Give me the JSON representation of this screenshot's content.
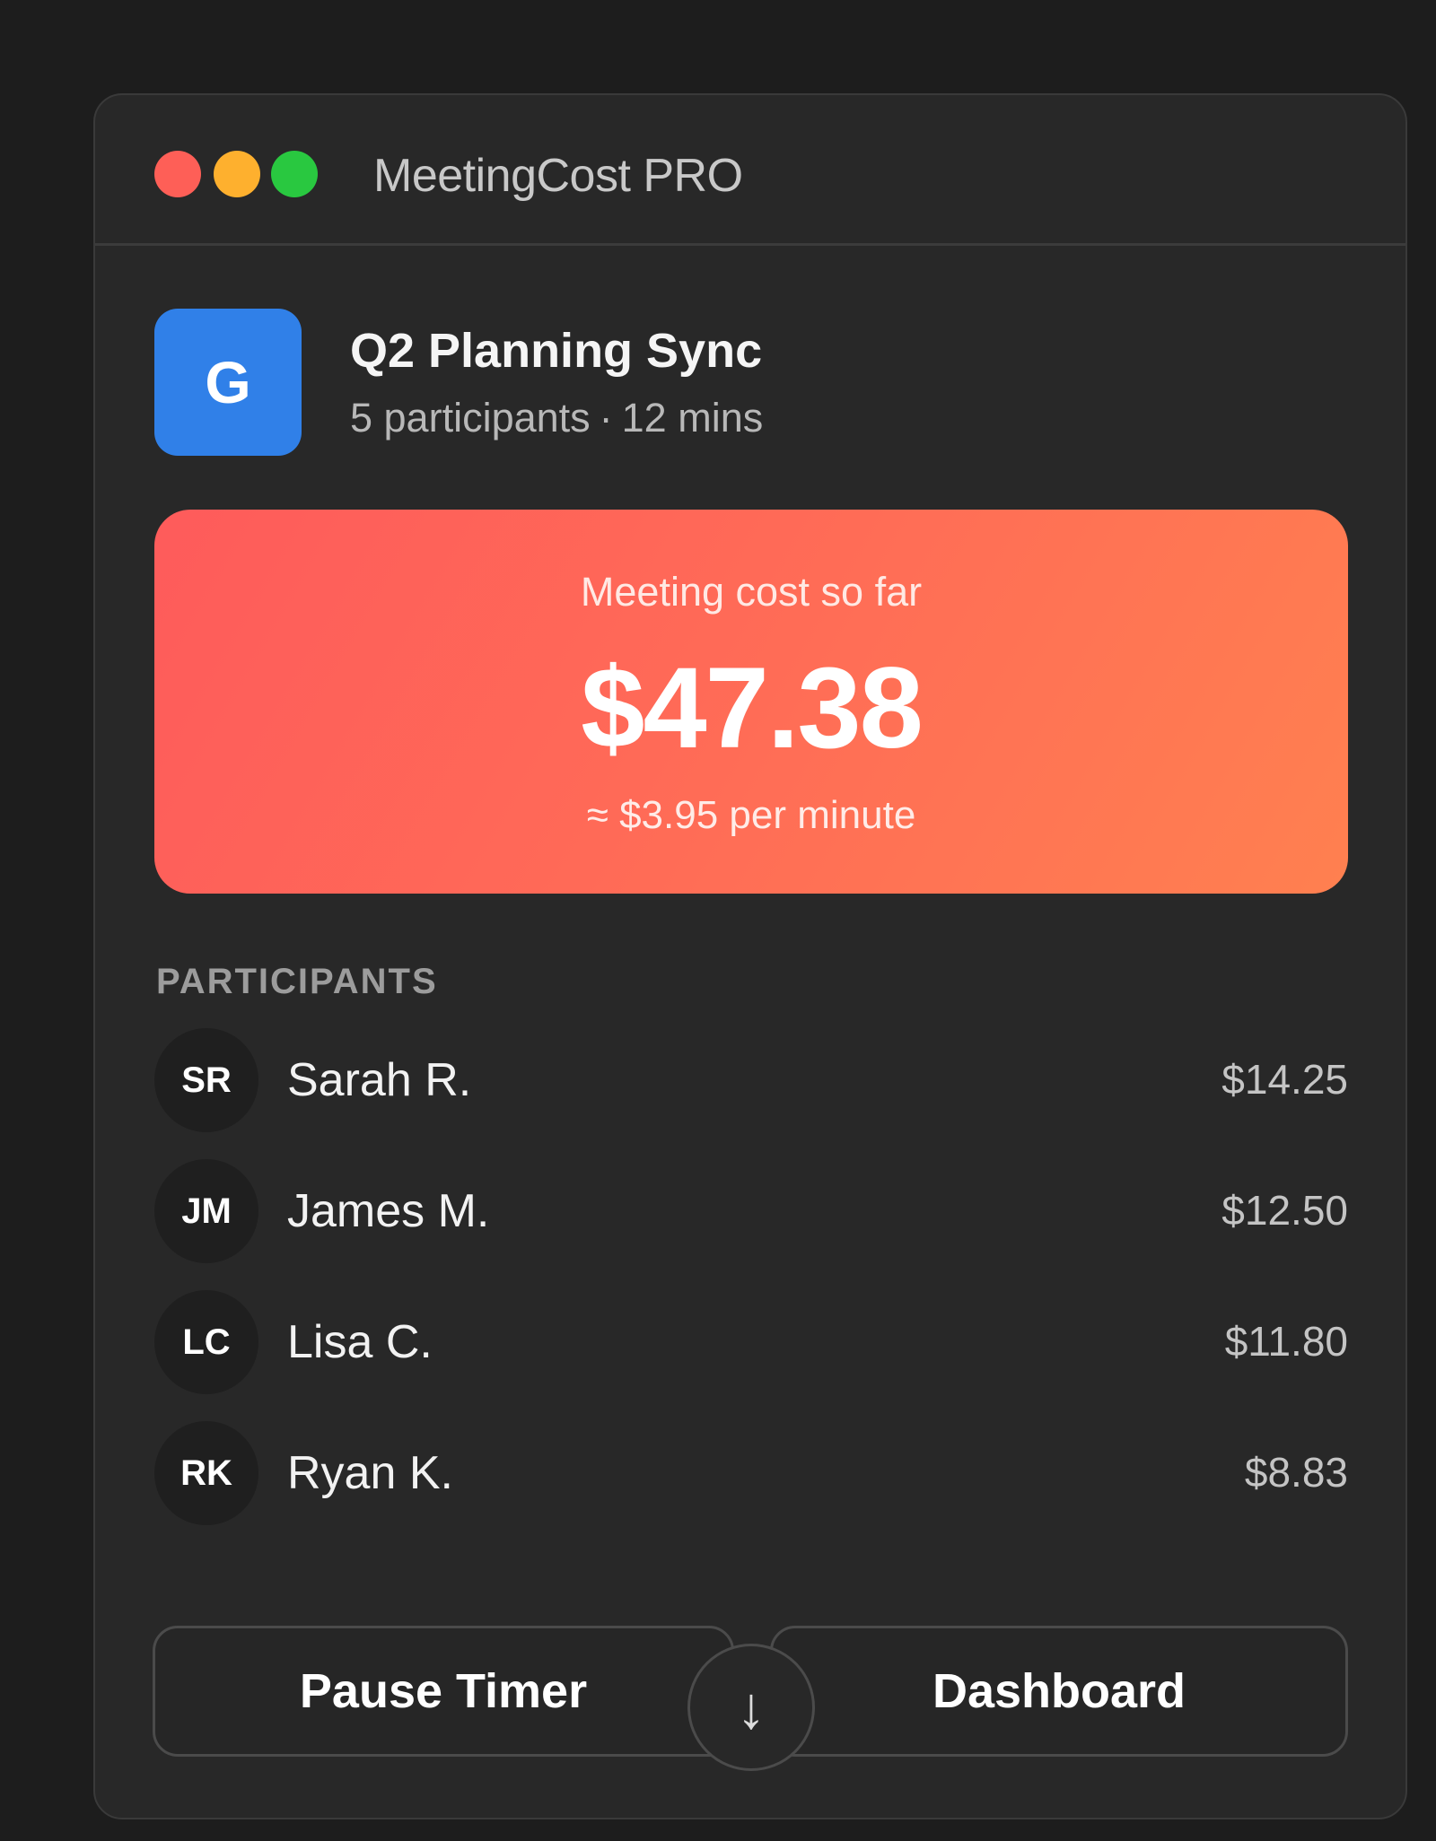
{
  "window": {
    "app_title": "MeetingCost PRO"
  },
  "meeting": {
    "app_icon_letter": "G",
    "title": "Q2 Planning Sync",
    "participants_text": "5 participants",
    "separator": "·",
    "duration_text": "12 mins"
  },
  "cost": {
    "label": "Meeting cost so far",
    "value": "$47.38",
    "rate": "≈ $3.95 per minute"
  },
  "participants": {
    "section_label": "PARTICIPANTS",
    "items": [
      {
        "initials": "SR",
        "name": "Sarah R.",
        "cost": "$14.25"
      },
      {
        "initials": "JM",
        "name": "James M.",
        "cost": "$12.50"
      },
      {
        "initials": "LC",
        "name": "Lisa C.",
        "cost": "$11.80"
      },
      {
        "initials": "RK",
        "name": "Ryan K.",
        "cost": "$8.83"
      }
    ]
  },
  "actions": {
    "pause_label": "Pause Timer",
    "dashboard_label": "Dashboard",
    "scroll_glyph": "↓"
  },
  "colors": {
    "accent_blue": "#3080e8",
    "card_gradient_start": "#fe5b5b",
    "card_gradient_end": "#ff8050",
    "light_red": "#fe5f57",
    "light_yellow": "#feb02e",
    "light_green": "#29c840"
  },
  "icons": {
    "close": "close-traffic-light-icon",
    "minimize": "minimize-traffic-light-icon",
    "zoom": "zoom-traffic-light-icon",
    "scroll": "arrow-down-icon"
  }
}
